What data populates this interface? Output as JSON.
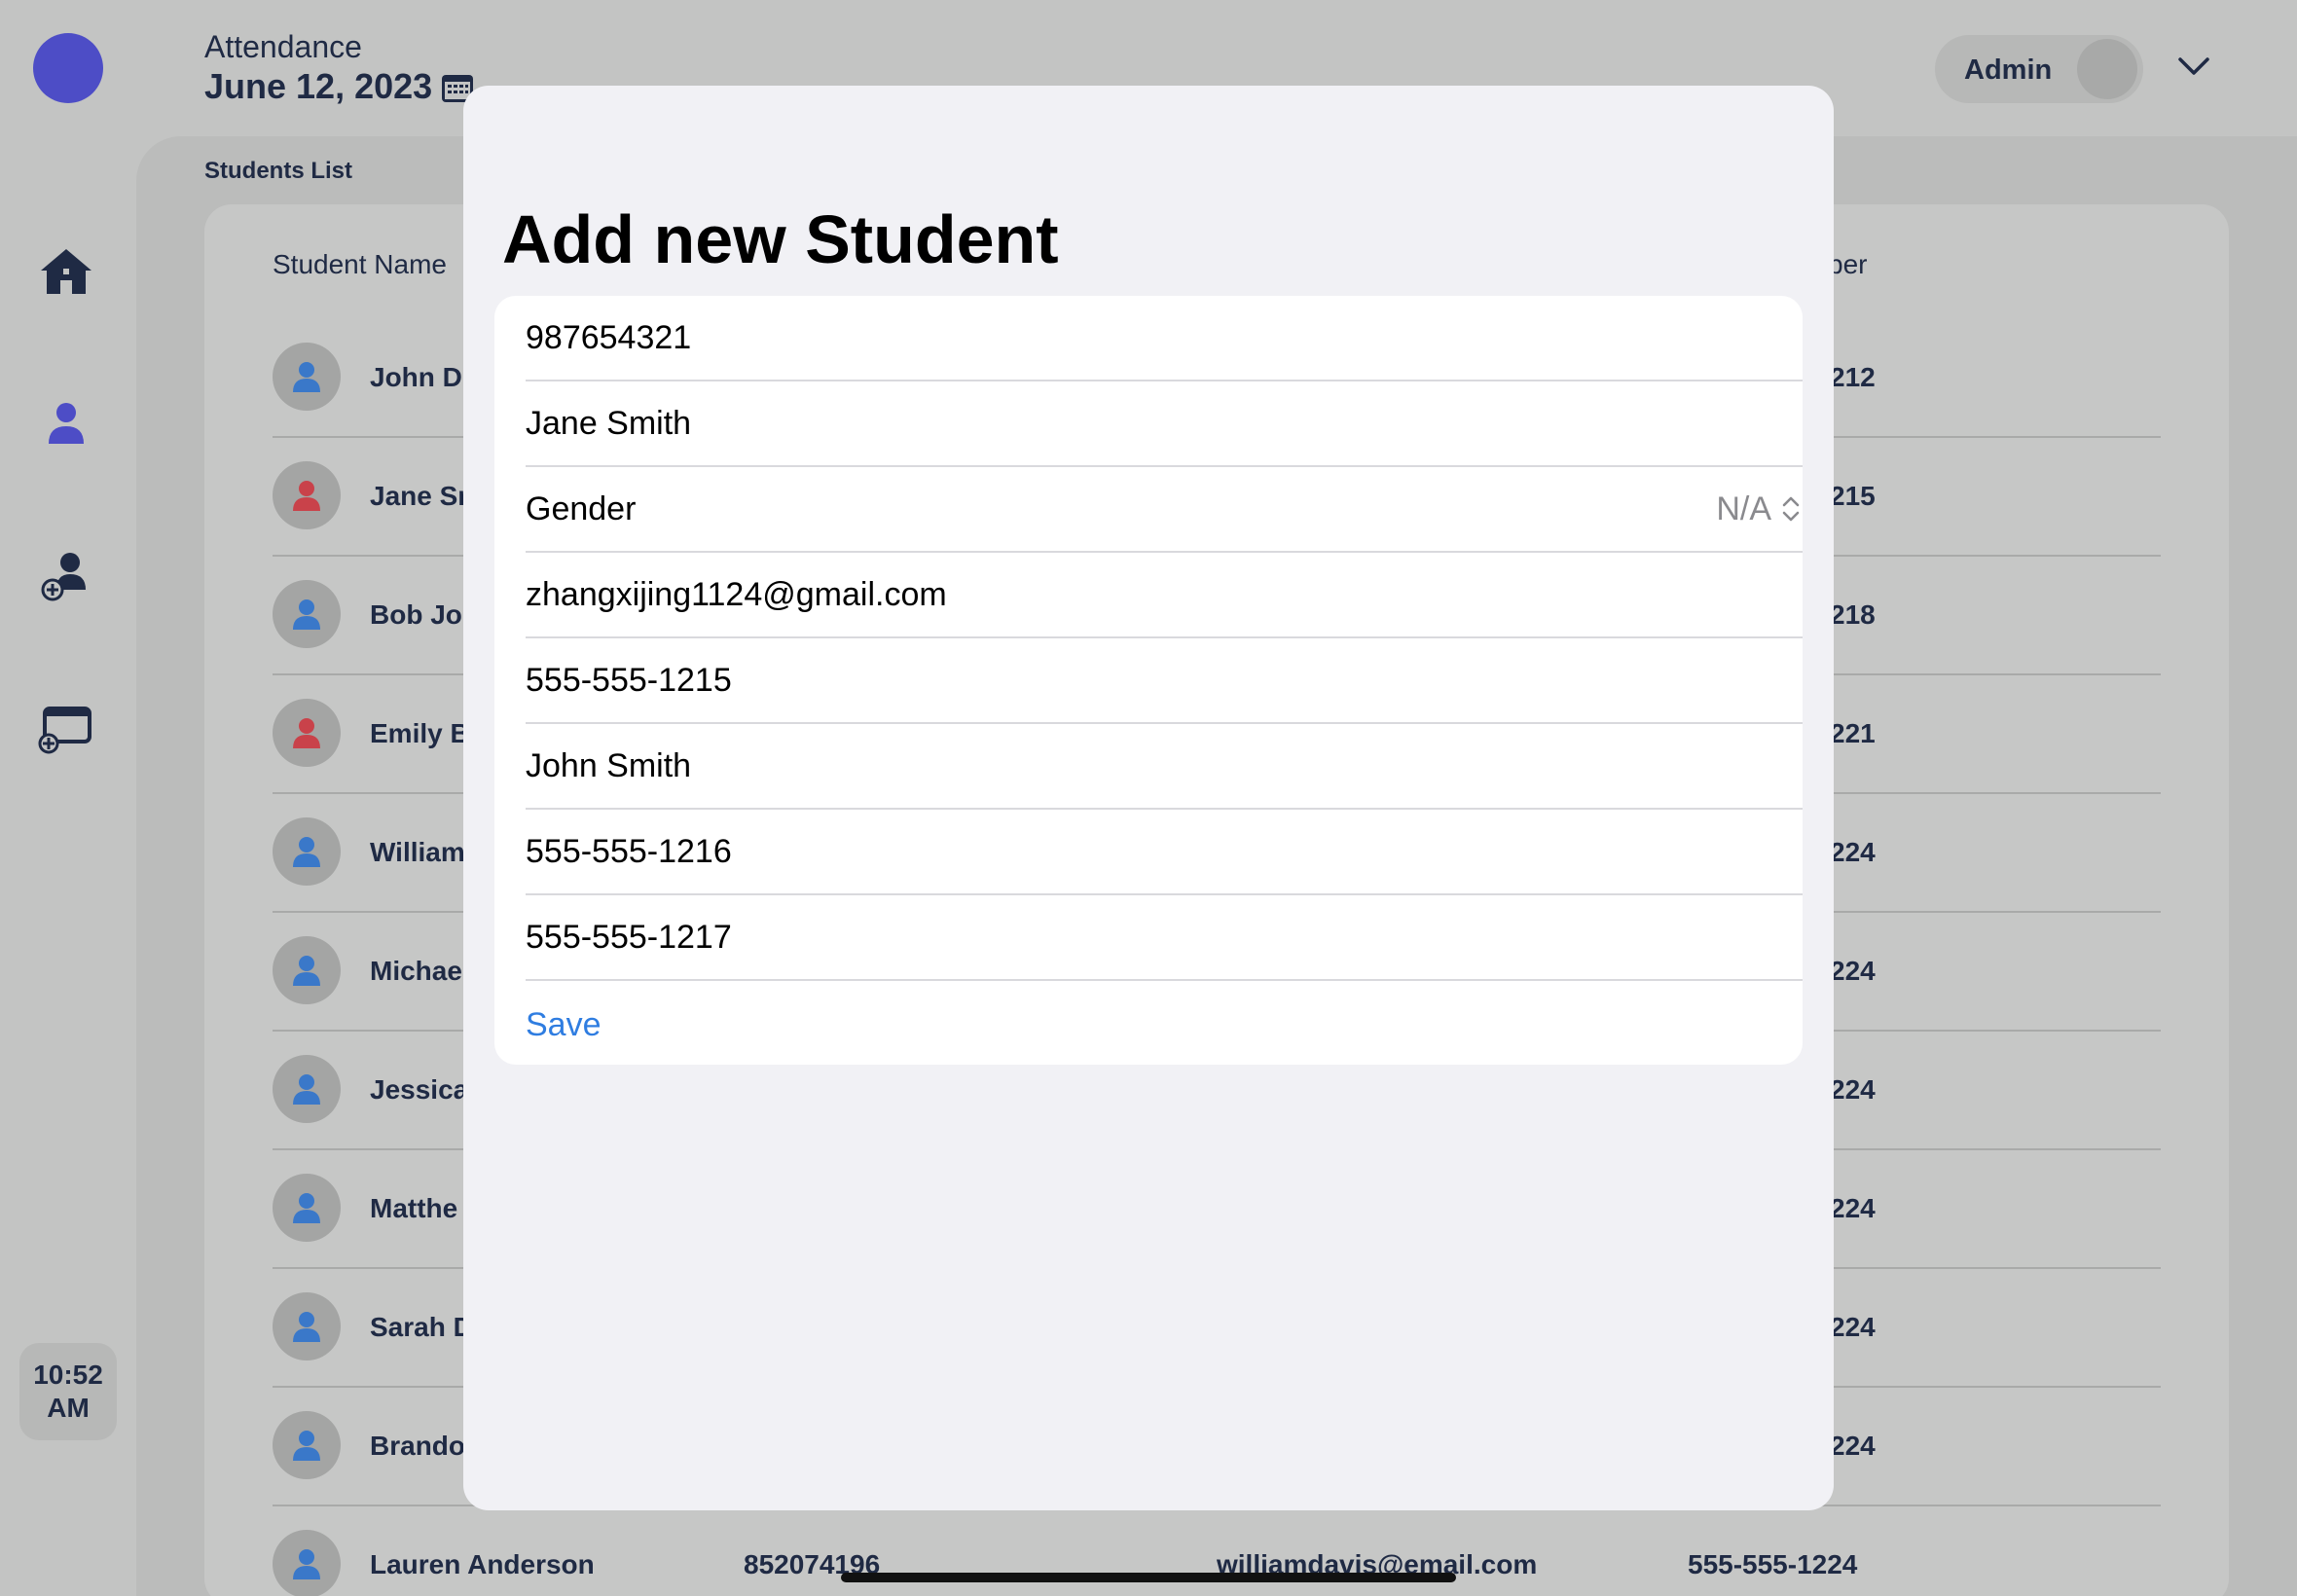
{
  "header": {
    "title": "Attendance",
    "date": "June 12, 2023",
    "admin_label": "Admin"
  },
  "sidebar": {
    "items": [
      {
        "icon": "home-icon"
      },
      {
        "icon": "user-icon"
      },
      {
        "icon": "add-user-icon"
      },
      {
        "icon": "add-class-icon"
      }
    ],
    "time": "10:52",
    "meridiem": "AM"
  },
  "students": {
    "section_label": "Students List",
    "columns": [
      "Student Name",
      "ber"
    ],
    "rows": [
      {
        "name": "John D",
        "phone": "212",
        "gender": "male"
      },
      {
        "name": "Jane Sr",
        "phone": "215",
        "gender": "female"
      },
      {
        "name": "Bob Jol",
        "phone": "218",
        "gender": "male"
      },
      {
        "name": "Emily B",
        "phone": "221",
        "gender": "female"
      },
      {
        "name": "William",
        "phone": "224",
        "gender": "male"
      },
      {
        "name": "Michae",
        "phone": "224",
        "gender": "male"
      },
      {
        "name": "Jessica",
        "phone": "224",
        "gender": "male"
      },
      {
        "name": "Matthe",
        "phone": "224",
        "gender": "male"
      },
      {
        "name": "Sarah D",
        "phone": "224",
        "gender": "male"
      },
      {
        "name": "Brando",
        "phone": "224",
        "gender": "male"
      },
      {
        "name": "Lauren Anderson",
        "id": "852074196",
        "email": "williamdavis@email.com",
        "phone": "555-555-1224",
        "gender": "male"
      }
    ]
  },
  "modal": {
    "title": "Add new Student",
    "fields": {
      "student_id": "987654321",
      "name": "Jane Smith",
      "gender_label": "Gender",
      "gender_value": "N/A",
      "email": "zhangxijing1124@gmail.com",
      "phone": "555-555-1215",
      "guardian_name": "John Smith",
      "guardian_phone": "555-555-1216",
      "emergency_phone": "555-555-1217"
    },
    "save_label": "Save"
  },
  "colors": {
    "accent": "#4d4dc6",
    "link": "#2f7de1",
    "male_avatar": "#3a78c9",
    "female_avatar": "#c9424a"
  }
}
